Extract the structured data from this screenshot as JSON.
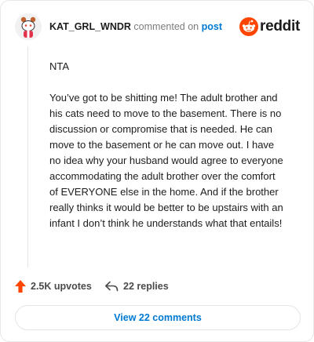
{
  "header": {
    "username": "KAT_GRL_WNDR",
    "action_text": "commented on",
    "post_link": "post",
    "brand": "reddit"
  },
  "comment": {
    "paragraphs": [
      "NTA",
      "You’ve got to be shitting me! The adult brother and his cats need to move to the basement. There is no discussion or compromise that is needed. He can move to the basement or he can move out. I have no idea why your husband would agree to everyone accommodating the adult brother over the comfort of EVERYONE else in the home. And if the brother really thinks it would be better to be upstairs with an infant I don’t think he understands what that entails!"
    ]
  },
  "stats": {
    "upvotes": "2.5K upvotes",
    "replies": "22 replies"
  },
  "footer": {
    "view_button": "View 22 comments"
  },
  "colors": {
    "brand_orange": "#ff4500",
    "link_blue": "#0079d3"
  },
  "icons": {
    "avatar": "snoo-avatar-icon",
    "logo": "reddit-logo-icon",
    "upvote": "upvote-arrow-icon",
    "reply": "reply-arrow-icon"
  }
}
